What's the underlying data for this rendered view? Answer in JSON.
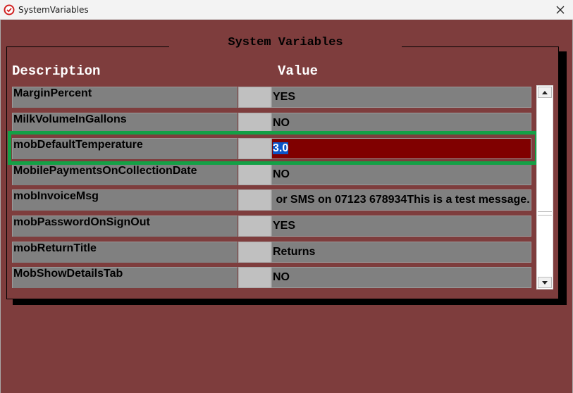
{
  "window": {
    "title": "SystemVariables"
  },
  "panel": {
    "title": "System Variables"
  },
  "columns": {
    "description": "Description",
    "value": "Value"
  },
  "rows": [
    {
      "description": "MarginPercent",
      "value": "YES"
    },
    {
      "description": "MilkVolumeInGallons",
      "value": "NO"
    },
    {
      "description": "mobDefaultTemperature",
      "value": "3.0"
    },
    {
      "description": "MobilePaymentsOnCollectionDate",
      "value": "NO"
    },
    {
      "description": "mobInvoiceMsg",
      "value": " or SMS on 07123 678934This is a test message."
    },
    {
      "description": "mobPasswordOnSignOut",
      "value": "YES"
    },
    {
      "description": "mobReturnTitle",
      "value": "Returns"
    },
    {
      "description": "MobShowDetailsTab",
      "value": "NO"
    }
  ],
  "selected_row": 2,
  "colors": {
    "background": "#7e3d3d",
    "selected_value_bg": "#800000",
    "highlight_box": "#14a046",
    "header_text": "#ffffff",
    "text_selection": "#0a54c8"
  }
}
